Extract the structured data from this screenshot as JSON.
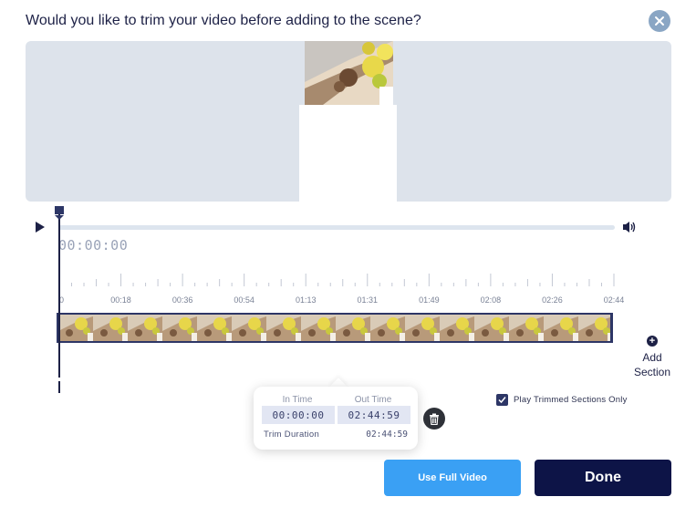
{
  "dialog": {
    "title": "Would you like to trim your video before adding to the scene?"
  },
  "player": {
    "current_time": "00:00:00"
  },
  "timeline": {
    "tick_labels": [
      "0",
      "00:18",
      "00:36",
      "00:54",
      "01:13",
      "01:31",
      "01:49",
      "02:08",
      "02:26",
      "02:44"
    ]
  },
  "add_section": {
    "line1": "Add",
    "line2": "Section"
  },
  "trim_popup": {
    "in_time_label": "In Time",
    "in_time_value": "00:00:00",
    "out_time_label": "Out Time",
    "out_time_value": "02:44:59",
    "duration_label": "Trim Duration",
    "duration_value": "02:44:59"
  },
  "options": {
    "play_trimmed_label": "Play Trimmed Sections Only",
    "play_trimmed_checked": true
  },
  "buttons": {
    "use_full_video": "Use Full Video",
    "done": "Done"
  },
  "colors": {
    "accent_dark": "#0d1447",
    "accent_blue": "#3aa0f4",
    "close_bg": "#8aa6c4",
    "preview_bg": "#dde3eb"
  }
}
